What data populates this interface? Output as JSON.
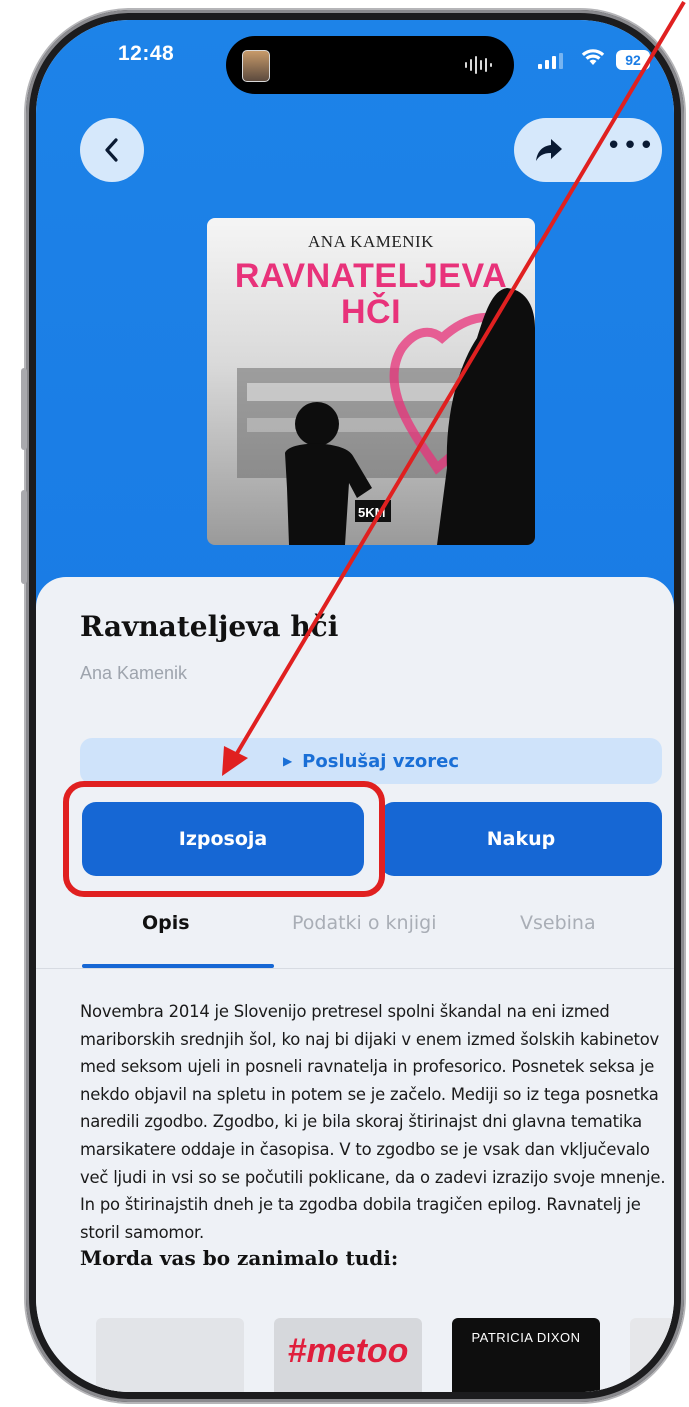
{
  "status_bar": {
    "time": "12:48",
    "battery": "92"
  },
  "icons": {
    "back": "chevron-left-icon",
    "share": "share-icon",
    "more": "more-icon",
    "wifi": "wifi-icon",
    "signal": "signal-icon",
    "play": "play-icon"
  },
  "cover": {
    "author_text": "ANA KAMENIK",
    "title_text": "RAVNATELJEVA\nHČI",
    "badge": "5KM"
  },
  "book": {
    "title": "Ravnateljeva hči",
    "author": "Ana Kamenik"
  },
  "actions": {
    "sample_label": "Poslušaj vzorec",
    "borrow_label": "Izposoja",
    "buy_label": "Nakup"
  },
  "tabs": [
    {
      "label": "Opis",
      "active": true
    },
    {
      "label": "Podatki o knjigi",
      "active": false
    },
    {
      "label": "Vsebina",
      "active": false
    }
  ],
  "description": "Novembra 2014 je Slovenijo pretresel spolni škandal na eni izmed mariborskih srednjih šol, ko naj bi dijaki v enem izmed šolskih kabinetov med seksom ujeli in posneli ravnatelja in profesorico. Posnetek seksa je nekdo objavil na spletu in potem se je začelo. Mediji so iz tega posnetka naredili zgodbo. Zgodbo, ki je bila skoraj štirinajst dni glavna tematika marsikatere oddaje in časopisa. V to zgodbo se je vsak dan vključevalo več ljudi in vsi so se počutili poklicane, da o zadevi izrazijo svoje mnenje. In po štirinajstih dneh je ta zgodba dobila tragičen epilog. Ravnatelj je storil samomor.",
  "suggestions": {
    "heading": "Morda vas bo zanimalo tudi:",
    "items": [
      {
        "text": ""
      },
      {
        "text": "#metoo"
      },
      {
        "text": "PATRICIA DIXON"
      },
      {
        "text": ""
      }
    ]
  },
  "annotation": {
    "color": "#e02020"
  },
  "colors": {
    "hero_blue": "#1a7ce5",
    "button_blue": "#1667d4",
    "sample_bg": "#cfe3fa",
    "sheet_bg": "#eef1f6"
  }
}
